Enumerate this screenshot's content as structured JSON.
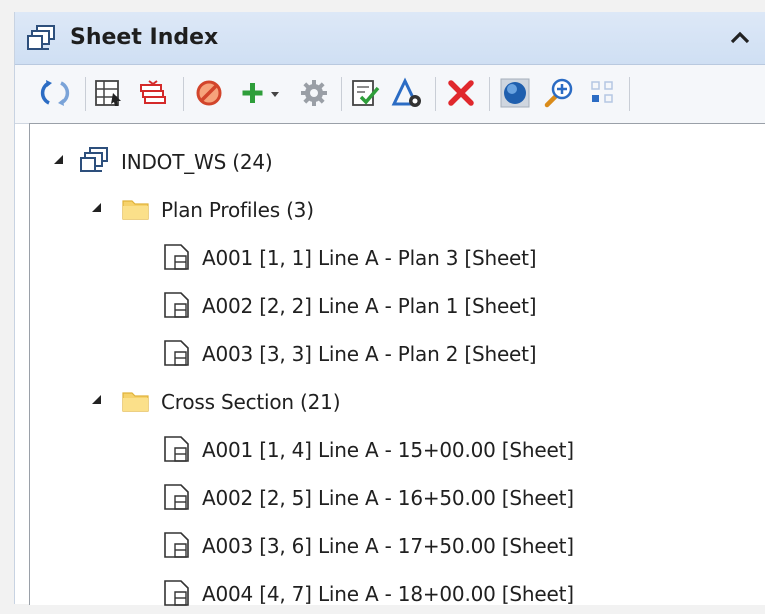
{
  "panel": {
    "title": "Sheet Index"
  },
  "toolbar": {
    "buttons": [
      {
        "name": "refresh-icon"
      },
      {
        "name": "sheet-layout-icon"
      },
      {
        "name": "multi-sheet-icon"
      },
      {
        "name": "cancel-circle-icon"
      },
      {
        "name": "add-dropdown-icon"
      },
      {
        "name": "settings-gear-icon"
      },
      {
        "name": "check-document-icon"
      },
      {
        "name": "triangle-tool-icon"
      },
      {
        "name": "delete-icon"
      },
      {
        "name": "globe-icon"
      },
      {
        "name": "zoom-in-icon"
      },
      {
        "name": "grid-dots-icon"
      }
    ]
  },
  "tree": {
    "root": {
      "label": "INDOT_WS (24)"
    },
    "folders": [
      {
        "label": "Plan Profiles (3)",
        "sheets": [
          "A001 [1, 1] Line A - Plan 3 [Sheet]",
          "A002 [2, 2] Line A - Plan 1 [Sheet]",
          "A003 [3, 3] Line A - Plan 2 [Sheet]"
        ]
      },
      {
        "label": "Cross Section (21)",
        "sheets": [
          "A001 [1, 4] Line A - 15+00.00 [Sheet]",
          "A002 [2, 5] Line A - 16+50.00 [Sheet]",
          "A003 [3, 6] Line A - 17+50.00 [Sheet]",
          "A004 [4, 7] Line A - 18+00.00 [Sheet]"
        ]
      }
    ]
  },
  "colors": {
    "header_bg": "#d6e4f5",
    "folder": "#f6d26b",
    "accent_red": "#e0282d",
    "accent_green": "#2e9e3a"
  }
}
